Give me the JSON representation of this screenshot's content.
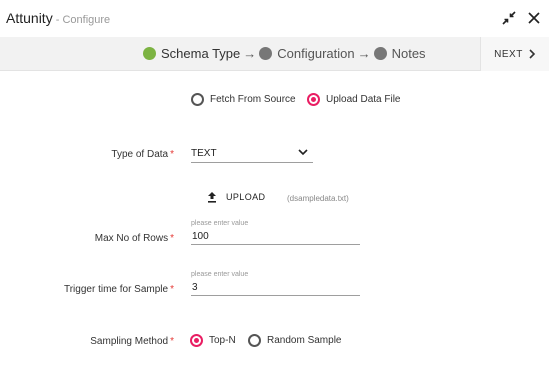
{
  "header": {
    "title": "Attunity",
    "subtitle": " - Configure",
    "icons": {
      "minimize": "collapse-arrows-icon",
      "close": "close-icon"
    }
  },
  "stepper": {
    "steps": [
      {
        "label": "Schema Type",
        "status": "done"
      },
      {
        "label": "Configuration",
        "status": "pending"
      },
      {
        "label": "Notes",
        "status": "pending"
      }
    ],
    "arrow": "→",
    "next_label": "NEXT"
  },
  "source": {
    "options": [
      {
        "label": "Fetch From Source",
        "selected": false
      },
      {
        "label": "Upload Data File",
        "selected": true
      }
    ]
  },
  "type_of_data": {
    "label": "Type of Data",
    "required": "*",
    "value": "TEXT"
  },
  "upload": {
    "label": "UPLOAD",
    "filename": "(dsampledata.txt)"
  },
  "max_rows": {
    "label": "Max No of Rows",
    "required": "*",
    "placeholder": "please enter value",
    "value": "100"
  },
  "trigger_time": {
    "label": "Trigger time for Sample",
    "required": "*",
    "placeholder": "please enter value",
    "value": "3"
  },
  "sampling": {
    "label": "Sampling Method",
    "required": "*",
    "options": [
      {
        "label": "Top-N",
        "selected": true
      },
      {
        "label": "Random Sample",
        "selected": false
      }
    ]
  },
  "colors": {
    "accent": "#e91e63",
    "done": "#7cb342",
    "required": "#e53935"
  }
}
